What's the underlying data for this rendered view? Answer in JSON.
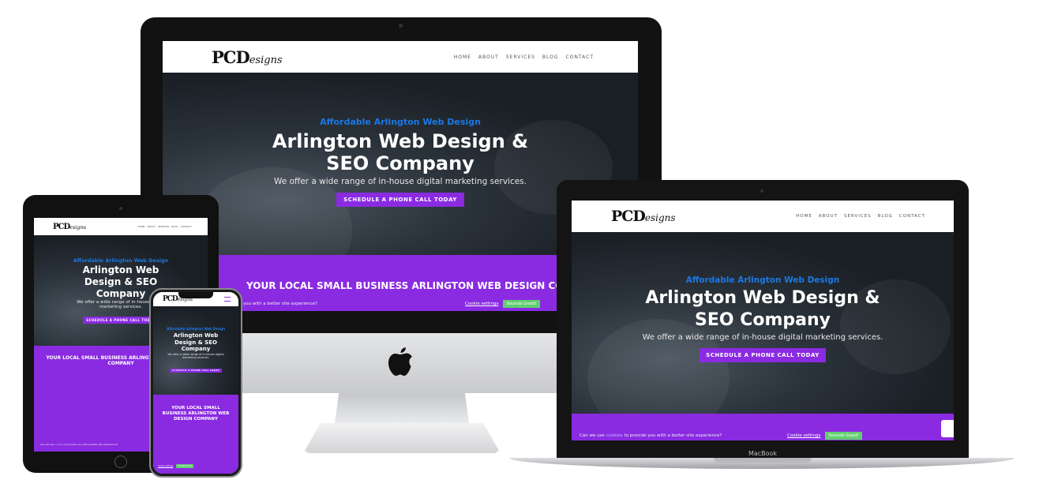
{
  "site": {
    "logo_main": "PCD",
    "logo_script": "esigns",
    "nav": [
      "HOME",
      "ABOUT",
      "SERVICES",
      "BLOG",
      "CONTACT"
    ],
    "eyebrow": "Affordable Arlington Web Design",
    "title_line1": "Arlington Web Design &",
    "title_line2": "SEO Company",
    "title_compact_1": "Arlington Web",
    "title_compact_2": "Design & SEO",
    "title_compact_3": "Company",
    "subtitle": "We offer a wide range of in-house digital marketing services.",
    "subtitle_compact_1": "We offer a wide range of in-house digital",
    "subtitle_compact_2": "marketing services.",
    "cta": "SCHEDULE A PHONE CALL TODAY",
    "section_heading": "YOUR LOCAL SMALL BUSINESS ARLINGTON WEB DESIGN COMPANY",
    "section_heading_tab_1": "YOUR LOCAL SMALL BUSINESS ARLINGTON WEB DESIGN",
    "section_heading_tab_2": "COMPANY",
    "section_heading_phone_1": "YOUR LOCAL SMALL",
    "section_heading_phone_2": "BUSINESS ARLINGTON WEB",
    "section_heading_phone_3": "DESIGN COMPANY",
    "cookie_prefix": "Can we use",
    "cookie_link": "cookies",
    "cookie_suffix": "to provide you with a better site experience?",
    "cookie_fragment": "you with a better site experience?",
    "cookie_settings": "Cookie settings",
    "cookie_ok": "Sounds Good!"
  },
  "devices": {
    "laptop_label": "MacBook"
  },
  "colors": {
    "purple": "#8a2be2",
    "eyebrow_blue": "#1a78e6",
    "cookie_green": "#61ce70"
  }
}
